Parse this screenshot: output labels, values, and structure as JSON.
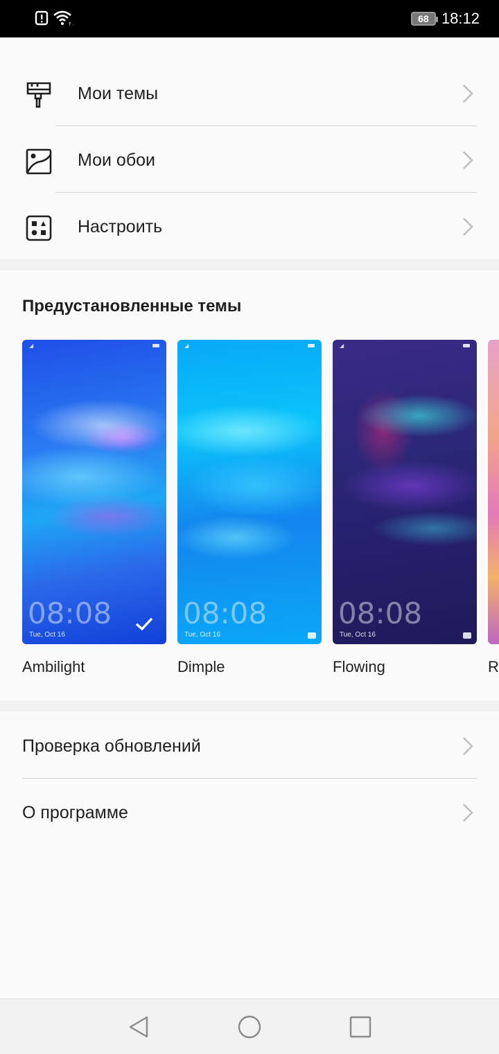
{
  "status_bar": {
    "left_icons": [
      "alert-icon",
      "wifi-icon"
    ],
    "battery": "68",
    "time": "18:12"
  },
  "menu": {
    "items": [
      {
        "label": "Мои темы",
        "icon": "paintbrush-icon"
      },
      {
        "label": "Мои обои",
        "icon": "wallpaper-icon"
      },
      {
        "label": "Настроить",
        "icon": "customize-icon"
      }
    ]
  },
  "preinstalled": {
    "title": "Предустановленные темы",
    "themes": [
      {
        "name": "Ambilight",
        "time": "08:08",
        "date": "Tue, Oct 16",
        "selected": true
      },
      {
        "name": "Dimple",
        "time": "08:08",
        "date": "Tue, Oct 16",
        "selected": false
      },
      {
        "name": "Flowing",
        "time": "08:08",
        "date": "Tue, Oct 16",
        "selected": false
      },
      {
        "name": "Ra",
        "time": "",
        "date": "",
        "selected": false
      }
    ]
  },
  "footer_menu": {
    "items": [
      {
        "label": "Проверка обновлений"
      },
      {
        "label": "О программе"
      }
    ]
  },
  "nav_bar": {
    "buttons": [
      "back-icon",
      "home-icon",
      "recents-icon"
    ]
  },
  "colors": {
    "background": "#f2f2f2",
    "card": "#fafafa",
    "text": "#1f1f1f",
    "chevron": "#bdbdbd"
  }
}
